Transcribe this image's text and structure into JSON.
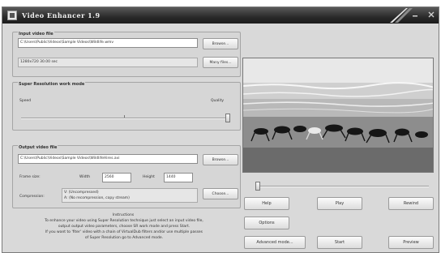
{
  "window": {
    "title": "Video Enhancer 1.9"
  },
  "input_group": {
    "label": "Input video file",
    "path": "C:\\Users\\Public\\Videos\\Sample Videos\\Wildlife.wmv",
    "browse_label": "Browse...",
    "info": "1280x720 30.00 sec",
    "more_files_label": "Many files..."
  },
  "sr_group": {
    "label": "Super Resolution work mode",
    "speed_label": "Speed",
    "quality_label": "Quality",
    "slider_value": 1.0
  },
  "output_group": {
    "label": "Output video file",
    "path": "C:\\Users\\Public\\Videos\\Sample Videos\\WildlifeHires.avi",
    "browse_label": "Browse...",
    "frame_size_label": "Frame size:",
    "width_label": "Width",
    "width_value": "2560",
    "height_label": "Height",
    "height_value": "1440",
    "compression_label": "Compression:",
    "compression_line1": "V: (Uncompressed)",
    "compression_line2": "A: (No recompression, copy stream)",
    "choose_label": "Choose..."
  },
  "instructions": {
    "title": "Instructions",
    "lines": [
      "To enhance your video using Super Resolution technique just select an input video file,",
      "output output video parameters, choose SR work mode and press Start.",
      "If you want to 'fiter' video with a chain of VirtualDub filters and/or use multiple passes",
      "of Super Resolution go to Advanced mode."
    ]
  },
  "player": {
    "position": 0.0,
    "help_label": "Help",
    "play_label": "Play",
    "rewind_label": "Rewind",
    "options_label": "Options",
    "advanced_label": "Advanced mode...",
    "start_label": "Start",
    "preview_label": "Preview"
  },
  "colors": {
    "window_bg": "#d9d9d9",
    "titlebar": "#2a2a2a",
    "preview_sky": "#e8e8e8",
    "preview_sea": "#b9b9b9",
    "preview_beach": "#8d8d8d"
  },
  "icons": [
    "app-icon",
    "minimize-icon",
    "maximize-icon",
    "close-icon"
  ]
}
